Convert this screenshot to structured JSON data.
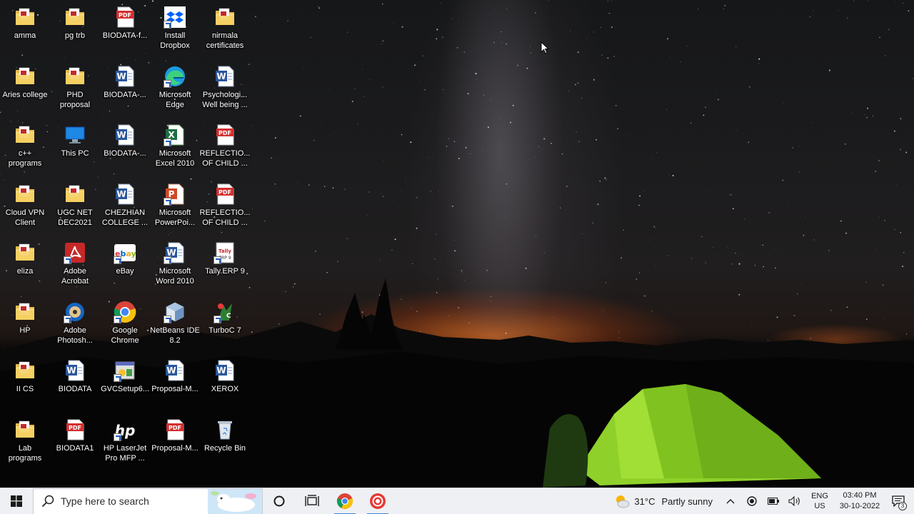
{
  "desktop": {
    "icons": [
      {
        "label": "amma",
        "icon": "folder-icon"
      },
      {
        "label": "Aries college",
        "icon": "folder-icon"
      },
      {
        "label": "c++\nprograms",
        "icon": "folder-icon"
      },
      {
        "label": "Cloud VPN\nClient",
        "icon": "folder-icon"
      },
      {
        "label": "eliza",
        "icon": "folder-icon"
      },
      {
        "label": "HP",
        "icon": "folder-icon"
      },
      {
        "label": "II CS",
        "icon": "folder-icon"
      },
      {
        "label": "Lab\nprograms",
        "icon": "folder-icon"
      },
      {
        "label": "pg trb",
        "icon": "folder-icon"
      },
      {
        "label": "PHD\nproposal",
        "icon": "folder-icon"
      },
      {
        "label": "This PC",
        "icon": "this-pc-icon"
      },
      {
        "label": "UGC NET\nDEC2021",
        "icon": "folder-icon"
      },
      {
        "label": "Adobe\nAcrobat",
        "icon": "adobe-acrobat-icon"
      },
      {
        "label": "Adobe\nPhotosh...",
        "icon": "adobe-photoshop-icon"
      },
      {
        "label": "BIODATA",
        "icon": "word-document-icon"
      },
      {
        "label": "BIODATA1",
        "icon": "pdf-document-icon"
      },
      {
        "label": "BIODATA-f...",
        "icon": "pdf-document-icon"
      },
      {
        "label": "BIODATA-...",
        "icon": "word-document-icon"
      },
      {
        "label": "BIODATA-...",
        "icon": "word-document-icon"
      },
      {
        "label": "CHEZHIAN\nCOLLEGE ...",
        "icon": "word-document-icon"
      },
      {
        "label": "eBay",
        "icon": "ebay-icon"
      },
      {
        "label": "Google\nChrome",
        "icon": "chrome-icon"
      },
      {
        "label": "GVCSetup6...",
        "icon": "setup-installer-icon"
      },
      {
        "label": "HP LaserJet\nPro MFP ...",
        "icon": "hp-icon"
      },
      {
        "label": "Install\nDropbox",
        "icon": "dropbox-icon"
      },
      {
        "label": "Microsoft\nEdge",
        "icon": "edge-icon"
      },
      {
        "label": "Microsoft\nExcel 2010",
        "icon": "excel-icon"
      },
      {
        "label": "Microsoft\nPowerPoi...",
        "icon": "powerpoint-icon"
      },
      {
        "label": "Microsoft\nWord 2010",
        "icon": "word-icon"
      },
      {
        "label": "NetBeans IDE\n8.2",
        "icon": "netbeans-icon"
      },
      {
        "label": "Proposal-M...",
        "icon": "word-document-icon"
      },
      {
        "label": "Proposal-M...",
        "icon": "pdf-document-icon"
      },
      {
        "label": "nirmala\ncertificates",
        "icon": "folder-icon"
      },
      {
        "label": "Psychologi...\nWell being ...",
        "icon": "word-document-icon"
      },
      {
        "label": "REFLECTIO...\nOF CHILD ...",
        "icon": "pdf-document-icon"
      },
      {
        "label": "REFLECTIO...\nOF CHILD ...",
        "icon": "pdf-document-icon"
      },
      {
        "label": "Tally.ERP 9",
        "icon": "tally-icon"
      },
      {
        "label": "TurboC 7",
        "icon": "turboc-icon"
      },
      {
        "label": "XEROX",
        "icon": "word-document-icon"
      },
      {
        "label": "Recycle Bin",
        "icon": "recycle-bin-icon"
      }
    ]
  },
  "taskbar": {
    "search_placeholder": "Type here to search",
    "weather_temp": "31°C",
    "weather_condition": "Partly sunny",
    "language_line1": "ENG",
    "language_line2": "US",
    "time": "03:40 PM",
    "date": "30-10-2022",
    "notification_count": "3"
  },
  "colors": {
    "taskbar_bg": "#eef0f3",
    "accent": "#3c7fd8",
    "tent_green": "#8fd12a"
  }
}
